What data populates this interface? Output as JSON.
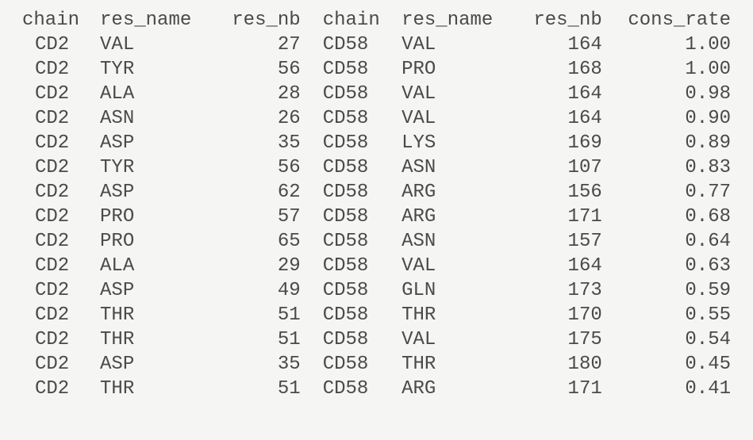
{
  "headers": {
    "chain1": "chain",
    "res_name1": "res_name",
    "res_nb1": "res_nb",
    "chain2": "chain",
    "res_name2": "res_name",
    "res_nb2": "res_nb",
    "cons_rate": "cons_rate"
  },
  "rows": [
    {
      "chain1": "CD2",
      "res_name1": "VAL",
      "res_nb1": "27",
      "chain2": "CD58",
      "res_name2": "VAL",
      "res_nb2": "164",
      "cons_rate": "1.00"
    },
    {
      "chain1": "CD2",
      "res_name1": "TYR",
      "res_nb1": "56",
      "chain2": "CD58",
      "res_name2": "PRO",
      "res_nb2": "168",
      "cons_rate": "1.00"
    },
    {
      "chain1": "CD2",
      "res_name1": "ALA",
      "res_nb1": "28",
      "chain2": "CD58",
      "res_name2": "VAL",
      "res_nb2": "164",
      "cons_rate": "0.98"
    },
    {
      "chain1": "CD2",
      "res_name1": "ASN",
      "res_nb1": "26",
      "chain2": "CD58",
      "res_name2": "VAL",
      "res_nb2": "164",
      "cons_rate": "0.90"
    },
    {
      "chain1": "CD2",
      "res_name1": "ASP",
      "res_nb1": "35",
      "chain2": "CD58",
      "res_name2": "LYS",
      "res_nb2": "169",
      "cons_rate": "0.89"
    },
    {
      "chain1": "CD2",
      "res_name1": "TYR",
      "res_nb1": "56",
      "chain2": "CD58",
      "res_name2": "ASN",
      "res_nb2": "107",
      "cons_rate": "0.83"
    },
    {
      "chain1": "CD2",
      "res_name1": "ASP",
      "res_nb1": "62",
      "chain2": "CD58",
      "res_name2": "ARG",
      "res_nb2": "156",
      "cons_rate": "0.77"
    },
    {
      "chain1": "CD2",
      "res_name1": "PRO",
      "res_nb1": "57",
      "chain2": "CD58",
      "res_name2": "ARG",
      "res_nb2": "171",
      "cons_rate": "0.68"
    },
    {
      "chain1": "CD2",
      "res_name1": "PRO",
      "res_nb1": "65",
      "chain2": "CD58",
      "res_name2": "ASN",
      "res_nb2": "157",
      "cons_rate": "0.64"
    },
    {
      "chain1": "CD2",
      "res_name1": "ALA",
      "res_nb1": "29",
      "chain2": "CD58",
      "res_name2": "VAL",
      "res_nb2": "164",
      "cons_rate": "0.63"
    },
    {
      "chain1": "CD2",
      "res_name1": "ASP",
      "res_nb1": "49",
      "chain2": "CD58",
      "res_name2": "GLN",
      "res_nb2": "173",
      "cons_rate": "0.59"
    },
    {
      "chain1": "CD2",
      "res_name1": "THR",
      "res_nb1": "51",
      "chain2": "CD58",
      "res_name2": "THR",
      "res_nb2": "170",
      "cons_rate": "0.55"
    },
    {
      "chain1": "CD2",
      "res_name1": "THR",
      "res_nb1": "51",
      "chain2": "CD58",
      "res_name2": "VAL",
      "res_nb2": "175",
      "cons_rate": "0.54"
    },
    {
      "chain1": "CD2",
      "res_name1": "ASP",
      "res_nb1": "35",
      "chain2": "CD58",
      "res_name2": "THR",
      "res_nb2": "180",
      "cons_rate": "0.45"
    },
    {
      "chain1": "CD2",
      "res_name1": "THR",
      "res_nb1": "51",
      "chain2": "CD58",
      "res_name2": "ARG",
      "res_nb2": "171",
      "cons_rate": "0.41"
    }
  ]
}
